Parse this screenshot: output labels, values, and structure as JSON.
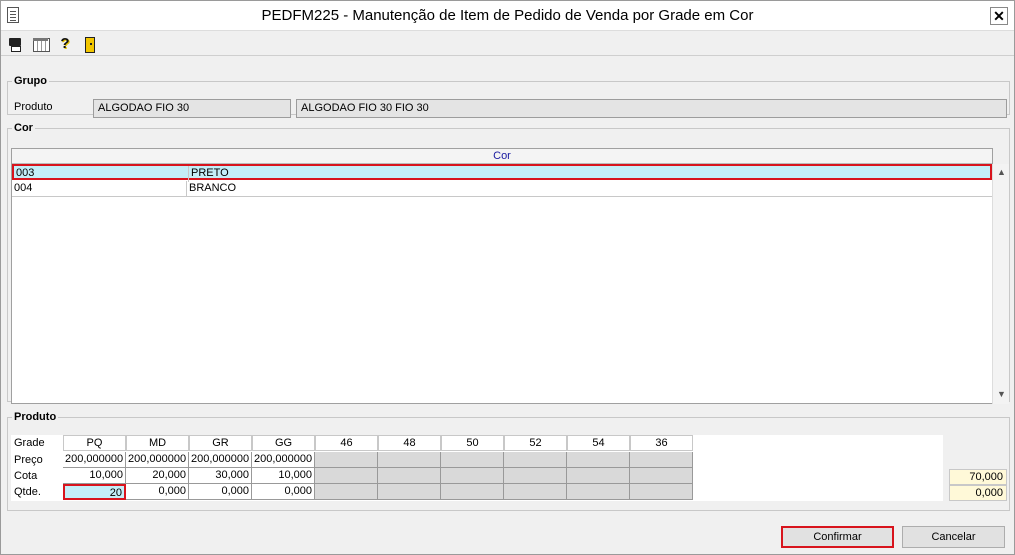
{
  "window": {
    "title": "PEDFM225 - Manutenção de Item de Pedido de Venda por Grade em Cor",
    "close_glyph": "✕"
  },
  "toolbar": {
    "icons": [
      "printer-icon",
      "calendar-icon",
      "help-icon",
      "exit-icon"
    ]
  },
  "grupo": {
    "legend": "Grupo",
    "produto_label": "Produto",
    "produto_code": "ALGODAO FIO 30",
    "produto_desc": "ALGODAO FIO 30 FIO 30"
  },
  "cor": {
    "legend": "Cor",
    "column_header": "Cor",
    "rows": [
      {
        "code": "003",
        "name": "PRETO",
        "selected": true
      },
      {
        "code": "004",
        "name": "BRANCO",
        "selected": false
      }
    ]
  },
  "produto": {
    "legend": "Produto",
    "row_labels": {
      "grade": "Grade",
      "preco": "Preço",
      "cota": "Cota",
      "qtde": "Qtde."
    },
    "sizes": [
      "PQ",
      "MD",
      "GR",
      "GG",
      "46",
      "48",
      "50",
      "52",
      "54",
      "36"
    ],
    "preco": [
      "200,000000",
      "200,000000",
      "200,000000",
      "200,000000",
      "",
      "",
      "",
      "",
      "",
      ""
    ],
    "cota": [
      "10,000",
      "20,000",
      "30,000",
      "10,000",
      "",
      "",
      "",
      "",
      "",
      ""
    ],
    "qtde": [
      "20",
      "0,000",
      "0,000",
      "0,000",
      "",
      "",
      "",
      "",
      "",
      ""
    ],
    "totals": {
      "cota": "70,000",
      "qtde": "0,000"
    }
  },
  "buttons": {
    "confirmar": "Confirmar",
    "cancelar": "Cancelar"
  }
}
